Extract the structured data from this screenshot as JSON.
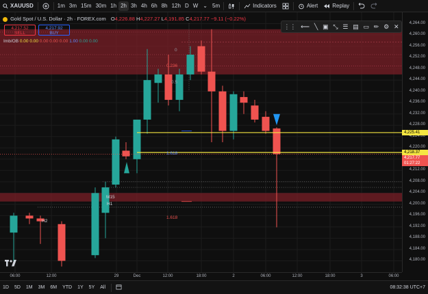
{
  "toolbar": {
    "symbol": "XAUUSD",
    "add_label": "+",
    "timeframes": [
      "1m",
      "3m",
      "15m",
      "30m",
      "1h",
      "2h",
      "3h",
      "4h",
      "6h",
      "8h",
      "12h",
      "D",
      "W",
      "5m"
    ],
    "active_timeframe": "2h",
    "indicators_label": "Indicators",
    "alert_label": "Alert",
    "replay_label": "Replay"
  },
  "legend": {
    "title": "Gold Spot / U.S. Dollar · 2h · FOREX.com",
    "o_label": "O",
    "o": "4,226.88",
    "h_label": "H",
    "h": "4,227.27",
    "l_label": "L",
    "l": "4,191.85",
    "c_label": "C",
    "c": "4,217.77",
    "change": "−9.11 (−0.22%)",
    "sell_price": "4,217.52",
    "sell_label": "SELL",
    "buy_price": "4,217.92",
    "buy_label": "BUY",
    "imb_label": "Imb/OB",
    "imb_values": [
      "0.00",
      "0.00",
      "0.00",
      "0.00",
      "0.00",
      "1.00",
      "0.00",
      "0.00"
    ]
  },
  "chart_labels": {
    "fib_0": "0",
    "fib_0236": "0.236",
    "fib_05": "0.5",
    "fib_1618_a": "1.618",
    "fib_1618_b": "1.618",
    "m15": "M15",
    "h1": "H1",
    "h2": "H2"
  },
  "price_axis": {
    "labels": [
      "4,264.00",
      "4,260.00",
      "4,256.00",
      "4,252.00",
      "4,248.00",
      "4,244.00",
      "4,240.00",
      "4,236.00",
      "4,232.00",
      "4,228.00",
      "4,224.00",
      "4,220.00",
      "4,216.00",
      "4,212.00",
      "4,208.00",
      "4,204.00",
      "4,200.00",
      "4,196.00",
      "4,192.00",
      "4,188.00",
      "4,184.00",
      "4,180.00"
    ],
    "tag_yellow": "4,225.41",
    "tag_current": "4,218.37",
    "tag_red_price": "4,217.77",
    "tag_red_timer": "01:27:22"
  },
  "time_axis": {
    "labels": [
      "06:00",
      "12:00",
      "29",
      "Dec",
      "12:00",
      "18:00",
      "2",
      "06:00",
      "12:00",
      "18:00",
      "3",
      "06:00"
    ]
  },
  "bottombar": {
    "ranges": [
      "1D",
      "5D",
      "1M",
      "3M",
      "6M",
      "YTD",
      "1Y",
      "5Y",
      "All"
    ],
    "clock": "08:32:38 UTC+7"
  },
  "colors": {
    "up": "#26a69a",
    "down": "#ef5350",
    "zone": "#7a1f27",
    "yellow": "#f5e642",
    "blue_marker": "#2196f3",
    "green_marker": "#26a69a"
  },
  "chart_data": {
    "type": "candlestick",
    "candles": [
      {
        "o": 4190,
        "h": 4197,
        "l": 4180,
        "c": 4196
      },
      {
        "o": 4196,
        "h": 4197,
        "l": 4193,
        "c": 4195
      },
      {
        "o": 4195,
        "h": 4196,
        "l": 4186,
        "c": 4194
      },
      {
        "o": 4193,
        "h": 4194,
        "l": 4178,
        "c": 4180
      },
      {
        "o": 4182,
        "h": 4206,
        "l": 4181,
        "c": 4204
      },
      {
        "o": 4197,
        "h": 4208,
        "l": 4188,
        "c": 4206
      },
      {
        "o": 4207,
        "h": 4224,
        "l": 4206,
        "c": 4223
      },
      {
        "o": 4219,
        "h": 4222,
        "l": 4216,
        "c": 4217
      },
      {
        "o": 4216,
        "h": 4230,
        "l": 4211,
        "c": 4230
      },
      {
        "o": 4230,
        "h": 4255,
        "l": 4225,
        "c": 4244
      },
      {
        "o": 4243,
        "h": 4248,
        "l": 4236,
        "c": 4246
      },
      {
        "o": 4246,
        "h": 4253,
        "l": 4235,
        "c": 4237
      },
      {
        "o": 4237,
        "h": 4248,
        "l": 4233,
        "c": 4246
      },
      {
        "o": 4246,
        "h": 4256,
        "l": 4244,
        "c": 4253
      },
      {
        "o": 4256,
        "h": 4258,
        "l": 4246,
        "c": 4247
      },
      {
        "o": 4247,
        "h": 4262,
        "l": 4222,
        "c": 4240
      },
      {
        "o": 4240,
        "h": 4242,
        "l": 4222,
        "c": 4226
      },
      {
        "o": 4226,
        "h": 4240,
        "l": 4223,
        "c": 4239
      },
      {
        "o": 4238,
        "h": 4240,
        "l": 4232,
        "c": 4236
      },
      {
        "o": 4235,
        "h": 4237,
        "l": 4229,
        "c": 4230
      },
      {
        "o": 4231,
        "h": 4233,
        "l": 4225,
        "c": 4226
      },
      {
        "o": 4226.88,
        "h": 4227.27,
        "l": 4191.85,
        "c": 4217.77
      }
    ],
    "ylim": [
      4176,
      4268
    ],
    "zones": [
      {
        "from": 4246,
        "to": 4262
      },
      {
        "from": 4201,
        "to": 4204
      }
    ],
    "hlines": [
      {
        "y": 4225.41,
        "color": "yellow"
      },
      {
        "y": 4218.37,
        "color": "yellow"
      }
    ]
  }
}
